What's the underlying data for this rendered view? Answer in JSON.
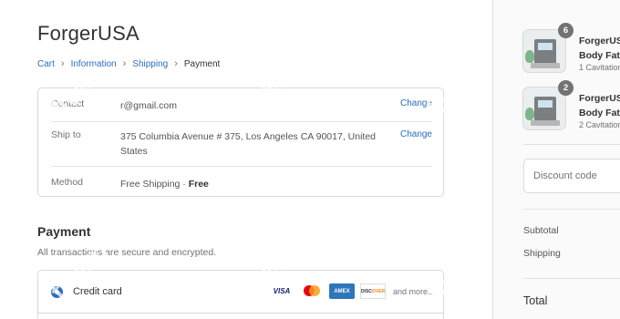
{
  "store": {
    "name": "ForgerUSA"
  },
  "breadcrumb": {
    "items": [
      {
        "label": "Cart"
      },
      {
        "label": "Information"
      },
      {
        "label": "Shipping"
      },
      {
        "label": "Payment"
      }
    ],
    "separator": "›"
  },
  "review": {
    "contact": {
      "label": "Contact",
      "value": "r@gmail.com",
      "action": "Change"
    },
    "ship_to": {
      "label": "Ship to",
      "value": "375 Columbia Avenue # 375, Los Angeles CA 90017, United States",
      "action": "Change"
    },
    "method": {
      "label": "Method",
      "value": "Free Shipping · ",
      "price": "Free"
    }
  },
  "payment": {
    "title": "Payment",
    "subtitle": "All transactions are secure and encrypted.",
    "credit_card_label": "Credit card",
    "card_logos": {
      "visa": "VISA",
      "amex": "AMEX",
      "discover": "DISC",
      "discover_accent": "OVER"
    },
    "and_more": "and more..."
  },
  "sidebar": {
    "products": [
      {
        "name_line1": "ForgerUS",
        "name_line2": "Body Fat",
        "variant": "1 Cavitation",
        "qty": "6"
      },
      {
        "name_line1": "ForgerUS",
        "name_line2": "Body Fat",
        "variant": "2 Cavitation",
        "qty": "2"
      }
    ],
    "discount_placeholder": "Discount code",
    "subtotal_label": "Subtotal",
    "shipping_label": "Shipping",
    "total_label": "Total"
  },
  "watermark": {
    "text": "fiverr."
  },
  "colors": {
    "accent": "#2a6ebb",
    "badge": "#737373",
    "text": "#333333",
    "muted": "#737373"
  }
}
